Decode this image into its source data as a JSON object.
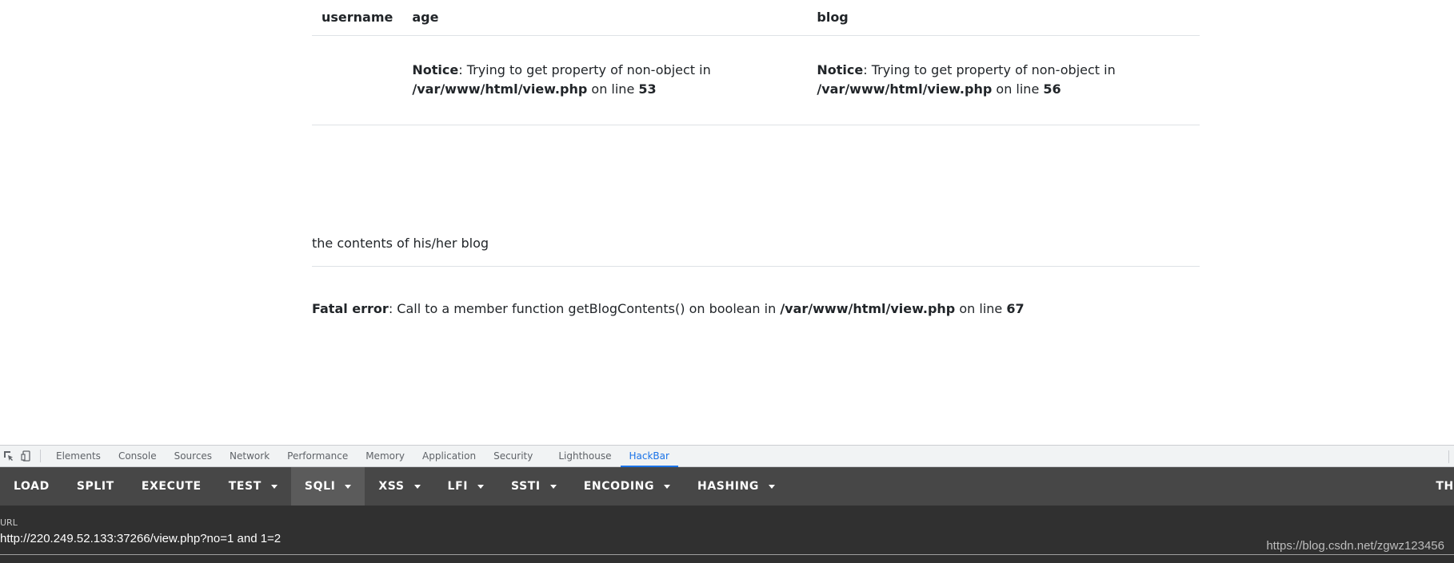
{
  "table": {
    "headers": {
      "username": "username",
      "age": "age",
      "blog": "blog"
    },
    "age_notice": {
      "label": "Notice",
      "text": ": Trying to get property of non-object in ",
      "path": "/var/www/html/view.php",
      "on_line": " on line ",
      "line": "53"
    },
    "blog_notice": {
      "label": "Notice",
      "text": ": Trying to get property of non-object in ",
      "path": "/var/www/html/view.php",
      "on_line": " on line ",
      "line": "56"
    }
  },
  "contents_label": "the contents of his/her blog",
  "fatal": {
    "label": "Fatal error",
    "text": ": Call to a member function getBlogContents() on boolean in ",
    "path": "/var/www/html/view.php",
    "on_line": " on line ",
    "line": "67"
  },
  "devtools": {
    "tabs": [
      "Elements",
      "Console",
      "Sources",
      "Network",
      "Performance",
      "Memory",
      "Application",
      "Security",
      "Lighthouse",
      "HackBar"
    ],
    "active_tab": "HackBar",
    "icons": [
      "inspect-icon",
      "device-toolbar-icon"
    ]
  },
  "hackbar": {
    "buttons": [
      {
        "label": "LOAD",
        "dropdown": false
      },
      {
        "label": "SPLIT",
        "dropdown": false
      },
      {
        "label": "EXECUTE",
        "dropdown": false
      },
      {
        "label": "TEST",
        "dropdown": true
      },
      {
        "label": "SQLI",
        "dropdown": true,
        "active": true
      },
      {
        "label": "XSS",
        "dropdown": true
      },
      {
        "label": "LFI",
        "dropdown": true
      },
      {
        "label": "SSTI",
        "dropdown": true
      },
      {
        "label": "ENCODING",
        "dropdown": true
      },
      {
        "label": "HASHING",
        "dropdown": true
      }
    ],
    "theme_label": "THE",
    "url_label": "URL",
    "url_value": "http://220.249.52.133:37266/view.php?no=1 and 1=2"
  },
  "watermark": "https://blog.csdn.net/zgwz123456",
  "colors": {
    "toolbar_bg": "#474747",
    "url_panel_bg": "#303030",
    "active_tab": "#1a73e8"
  }
}
